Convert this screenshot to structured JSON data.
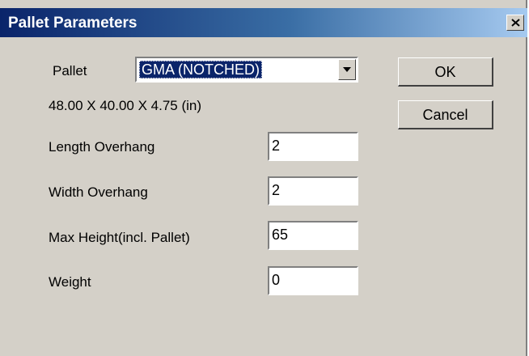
{
  "window": {
    "title": "Pallet Parameters",
    "close_label": "X"
  },
  "pallet": {
    "label": "Pallet",
    "selected": "GMA (NOTCHED)",
    "dimensions": "48.00 X 40.00 X 4.75  (in)"
  },
  "fields": {
    "length_overhang": {
      "label": "Length Overhang",
      "value": "2"
    },
    "width_overhang": {
      "label": "Width Overhang",
      "value": "2"
    },
    "max_height": {
      "label": "Max Height(incl. Pallet)",
      "value": "65"
    },
    "weight": {
      "label": "Weight",
      "value": "0"
    }
  },
  "buttons": {
    "ok": "OK",
    "cancel": "Cancel"
  },
  "icons": {
    "close": "close-icon",
    "dropdown": "chevron-down-icon"
  },
  "colors": {
    "title_start": "#0a246a",
    "title_end": "#a6caf0",
    "dialog_bg": "#d4d0c8",
    "selection_bg": "#0a246a"
  }
}
